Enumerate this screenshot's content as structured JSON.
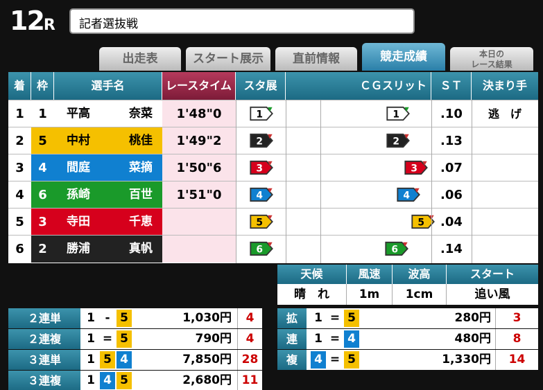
{
  "header": {
    "race_number": "12",
    "race_suffix": "R",
    "race_title": "記者選抜戦"
  },
  "tabs": [
    {
      "label": "出走表",
      "active": false
    },
    {
      "label": "スタート展示",
      "active": false
    },
    {
      "label": "直前情報",
      "active": false
    },
    {
      "label": "競走成績",
      "active": true
    },
    {
      "label_line1": "本日の",
      "label_line2": "レース結果",
      "active": false
    }
  ],
  "columns": {
    "rank": "着",
    "waku": "枠",
    "name": "選手名",
    "time": "レースタイム",
    "start_exhibit": "スタ展",
    "cg_slit": "ＣＧスリット",
    "st": "ＳＴ",
    "kimarite": "決まり手"
  },
  "colors": {
    "1": "#ffffff",
    "2": "#222222",
    "3": "#d6001c",
    "4": "#1080d0",
    "5": "#f5c000",
    "6": "#1a9a2a"
  },
  "results": [
    {
      "rank": "1",
      "waku": "1",
      "last": "平高",
      "first": "奈菜",
      "time": "1'48\"0",
      "st": ".10",
      "kimarite": "逃　げ"
    },
    {
      "rank": "2",
      "waku": "5",
      "last": "中村",
      "first": "桃佳",
      "time": "1'49\"2",
      "st": ".13",
      "kimarite": ""
    },
    {
      "rank": "3",
      "waku": "4",
      "last": "間庭",
      "first": "菜摘",
      "time": "1'50\"6",
      "st": ".07",
      "kimarite": ""
    },
    {
      "rank": "4",
      "waku": "6",
      "last": "孫崎",
      "first": "百世",
      "time": "1'51\"0",
      "st": ".06",
      "kimarite": ""
    },
    {
      "rank": "5",
      "waku": "3",
      "last": "寺田",
      "first": "千恵",
      "time": "",
      "st": ".04",
      "kimarite": ""
    },
    {
      "rank": "6",
      "waku": "2",
      "last": "勝浦",
      "first": "真帆",
      "time": "",
      "st": ".14",
      "kimarite": ""
    }
  ],
  "start_exhibit_order": [
    "1",
    "2",
    "3",
    "4",
    "5",
    "6"
  ],
  "slit": [
    {
      "boat": "1",
      "offset": 0.73
    },
    {
      "boat": "2",
      "offset": 0.73
    },
    {
      "boat": "3",
      "offset": 0.85
    },
    {
      "boat": "4",
      "offset": 0.8
    },
    {
      "boat": "5",
      "offset": 0.9
    },
    {
      "boat": "6",
      "offset": 0.72
    }
  ],
  "weather": {
    "headers": [
      "天候",
      "風速",
      "波高",
      "スタート"
    ],
    "values": [
      "晴　れ",
      "1m",
      "1cm",
      "追い風"
    ]
  },
  "payouts_left": [
    {
      "label": "２連単",
      "nums": [
        "1",
        "-",
        "5"
      ],
      "amount": "1,030円",
      "pop": "4"
    },
    {
      "label": "２連複",
      "nums": [
        "1",
        "=",
        "5"
      ],
      "amount": "790円",
      "pop": "4"
    },
    {
      "label": "３連単",
      "nums": [
        "1",
        "5",
        "4"
      ],
      "amount": "7,850円",
      "pop": "28"
    },
    {
      "label": "３連複",
      "nums": [
        "1",
        "4",
        "5"
      ],
      "amount": "2,680円",
      "pop": "11"
    }
  ],
  "payouts_right_label": [
    "拡",
    "連",
    "複"
  ],
  "payouts_right": [
    {
      "nums": [
        "1",
        "=",
        "5"
      ],
      "amount": "280円",
      "pop": "3"
    },
    {
      "nums": [
        "1",
        "=",
        "4"
      ],
      "amount": "480円",
      "pop": "8"
    },
    {
      "nums": [
        "4",
        "=",
        "5"
      ],
      "amount": "1,330円",
      "pop": "14"
    }
  ]
}
